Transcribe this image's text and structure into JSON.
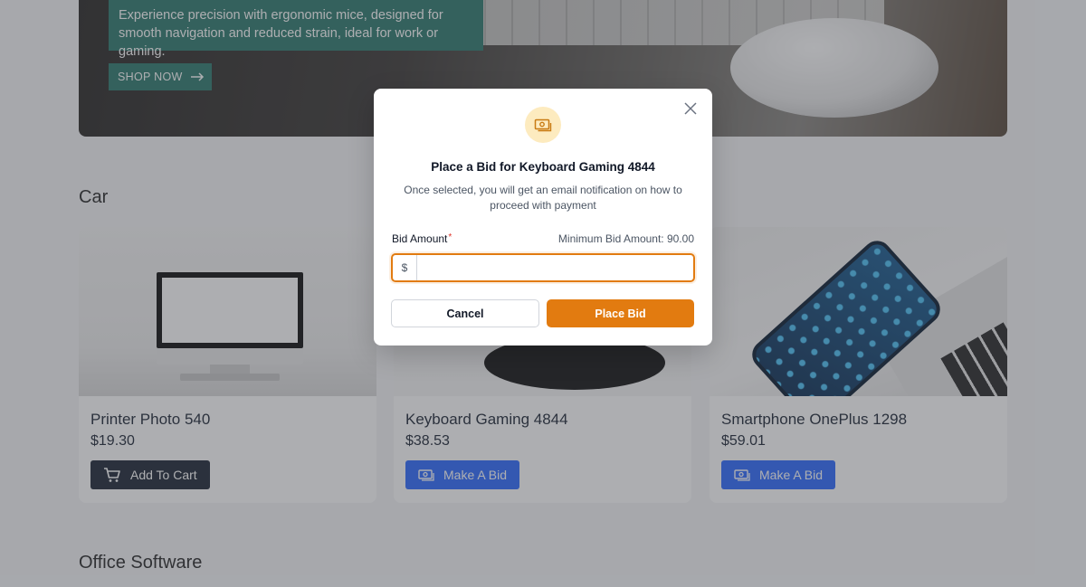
{
  "hero": {
    "description": "Experience precision with ergonomic mice, designed for smooth navigation and reduced strain, ideal for work or gaming.",
    "cta_label": "SHOP NOW"
  },
  "sections": {
    "car_title": "Car",
    "office_software_title": "Office Software"
  },
  "products": [
    {
      "name": "Printer Photo 540",
      "price": "$19.30",
      "action": "Add To Cart",
      "action_icon": "cart-icon"
    },
    {
      "name": "Keyboard Gaming 4844",
      "price": "$38.53",
      "action": "Make A Bid",
      "action_icon": "money-icon"
    },
    {
      "name": "Smartphone OnePlus 1298",
      "price": "$59.01",
      "action": "Make A Bid",
      "action_icon": "money-icon"
    }
  ],
  "modal": {
    "icon": "money-icon",
    "title": "Place a Bid for Keyboard Gaming 4844",
    "subtitle": "Once selected, you will get an email notification on how to proceed with payment",
    "field_label": "Bid Amount",
    "required_marker": "*",
    "minimum_text": "Minimum Bid Amount: 90.00",
    "currency_symbol": "$",
    "bid_value": "",
    "cancel_label": "Cancel",
    "submit_label": "Place Bid"
  },
  "colors": {
    "accent": "#e27b10",
    "accent_light": "#fdebbf",
    "bid_button": "#2f6bff",
    "cart_button": "#1f2937",
    "hero_teal": "#2f7b6e"
  }
}
